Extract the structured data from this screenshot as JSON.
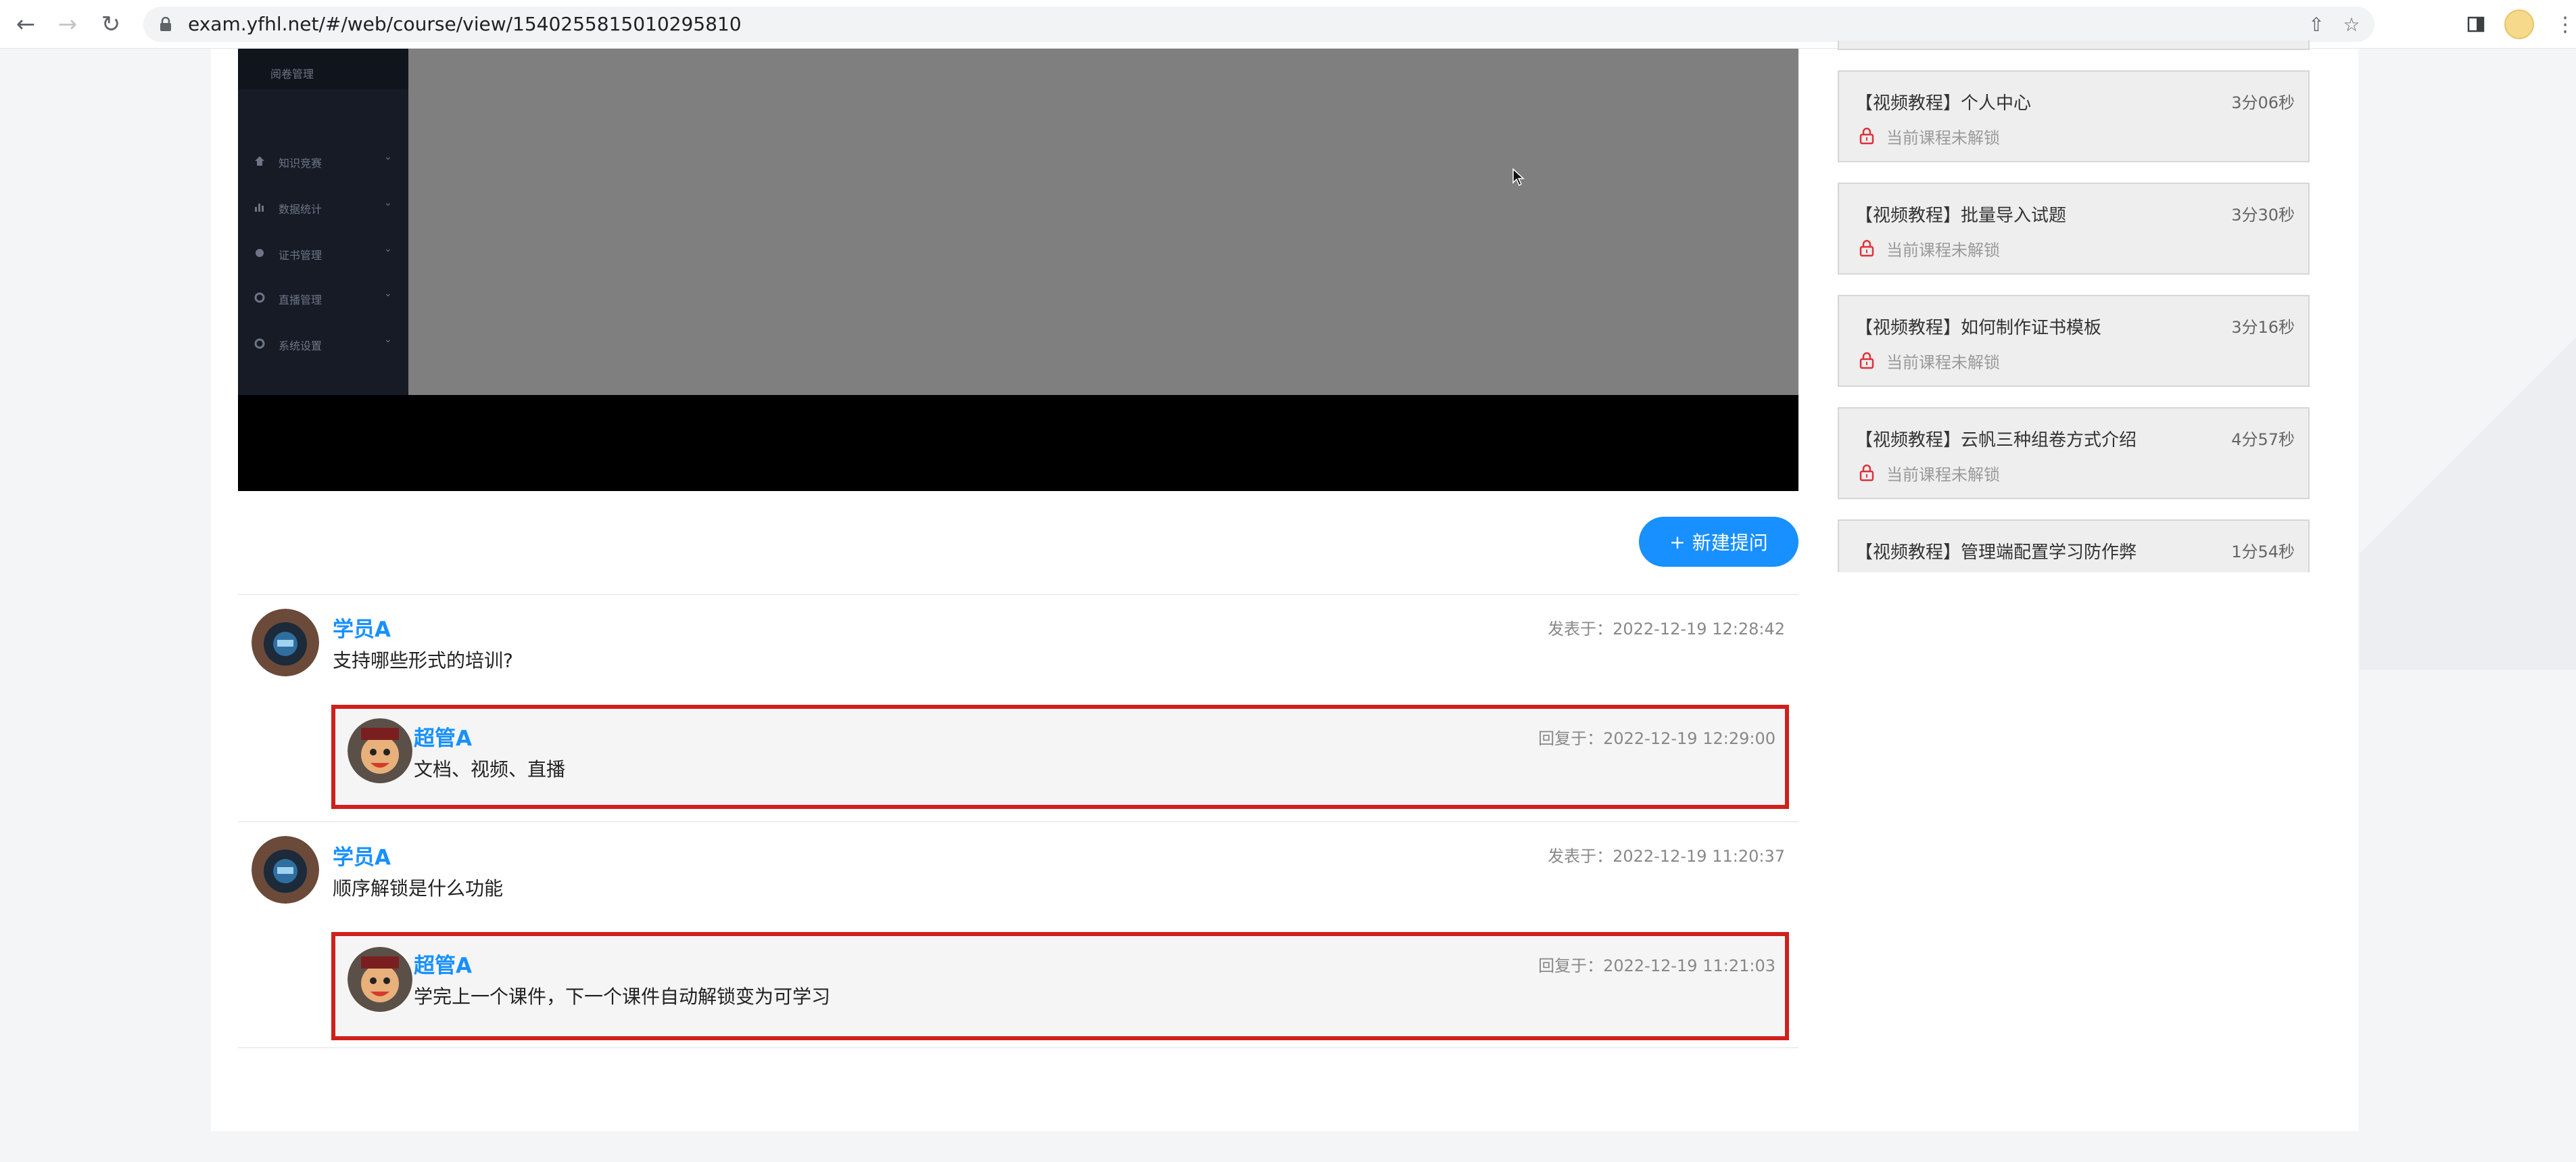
{
  "browser": {
    "url": "exam.yfhl.net/#/web/course/view/1540255815010295810"
  },
  "video": {
    "sidebar_header": "阅卷管理",
    "sidebar_items": [
      {
        "label": "知识竞赛"
      },
      {
        "label": "数据统计"
      },
      {
        "label": "证书管理"
      },
      {
        "label": "直播管理"
      },
      {
        "label": "系统设置"
      }
    ]
  },
  "qa": {
    "new_question_label": "新建提问",
    "threads": [
      {
        "author": "学员A",
        "meta_label": "发表于：",
        "time": "2022-12-19 12:28:42",
        "text": "支持哪些形式的培训?",
        "reply": {
          "author": "超管A",
          "meta_label": "回复于：",
          "time": "2022-12-19 12:29:00",
          "text": "文档、视频、直播"
        }
      },
      {
        "author": "学员A",
        "meta_label": "发表于：",
        "time": "2022-12-19 11:20:37",
        "text": "顺序解锁是什么功能",
        "reply": {
          "author": "超管A",
          "meta_label": "回复于：",
          "time": "2022-12-19 11:21:03",
          "text": "学完上一个课件，下一个课件自动解锁变为可学习"
        }
      }
    ]
  },
  "lessons": [
    {
      "title": "【视频教程】个人中心",
      "duration": "3分06秒",
      "status": "当前课程未解锁"
    },
    {
      "title": "【视频教程】批量导入试题",
      "duration": "3分30秒",
      "status": "当前课程未解锁"
    },
    {
      "title": "【视频教程】如何制作证书模板",
      "duration": "3分16秒",
      "status": "当前课程未解锁"
    },
    {
      "title": "【视频教程】云帆三种组卷方式介绍",
      "duration": "4分57秒",
      "status": "当前课程未解锁"
    },
    {
      "title": "【视频教程】管理端配置学习防作弊",
      "duration": "1分54秒",
      "status": ""
    }
  ],
  "colors": {
    "accent": "#1890ff",
    "highlight_border": "#d0201b",
    "lock": "#e0313a"
  }
}
